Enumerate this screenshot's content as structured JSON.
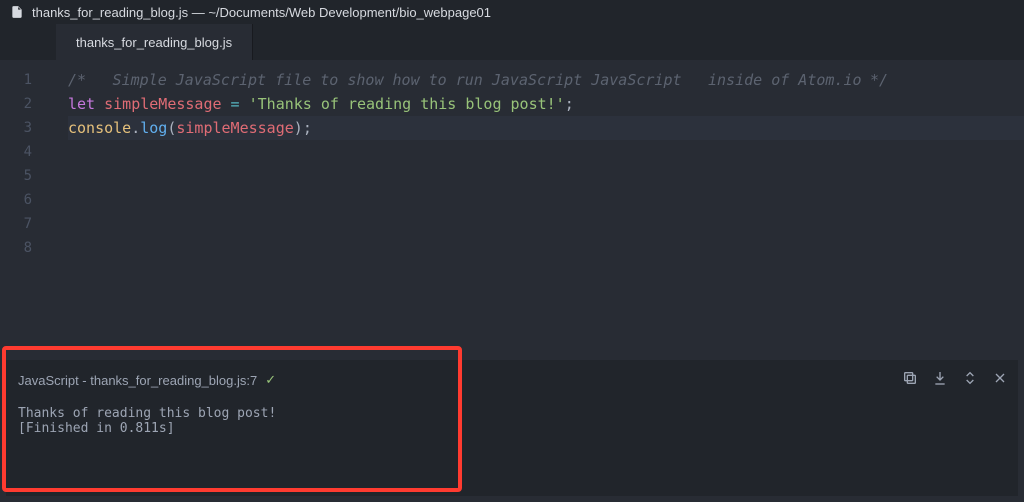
{
  "window": {
    "title": "thanks_for_reading_blog.js — ~/Documents/Web Development/bio_webpage01"
  },
  "tab": {
    "label": "thanks_for_reading_blog.js"
  },
  "code": {
    "lines": [
      "",
      "/*",
      "  Simple JavaScript file to show how to run JavaScript JavaScript",
      "  inside of Atom.io",
      "*/",
      "let simpleMessage = 'Thanks of reading this blog post!';",
      "console.log(simpleMessage);",
      ""
    ],
    "l6": {
      "kw": "let",
      "var": "simpleMessage",
      "eq": " = ",
      "str": "'Thanks of reading this blog post!'",
      "semi": ";"
    },
    "l7": {
      "obj": "console",
      "dot": ".",
      "fn": "log",
      "open": "(",
      "arg": "simpleMessage",
      "close": ")",
      "semi": ";"
    }
  },
  "panel": {
    "header": "JavaScript - thanks_for_reading_blog.js:7",
    "status": "✓",
    "output_line1": "Thanks of reading this blog post!",
    "output_line2": "[Finished in 0.811s]"
  }
}
